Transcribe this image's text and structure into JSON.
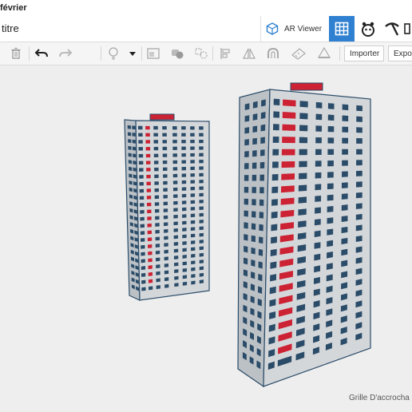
{
  "top_strip": {
    "text": "février"
  },
  "header": {
    "title": "titre",
    "ar_viewer_label": "AR Viewer",
    "grid_icon": "grid-icon",
    "blocks_icon": "blocks-icon",
    "pickaxe_icon": "pickaxe-icon"
  },
  "toolbar": {
    "icons": [
      "trash-icon",
      "undo-icon",
      "redo-icon",
      "lightbulb-icon",
      "chevron-down-icon",
      "image-icon",
      "group-icon",
      "ungroup-icon",
      "align-icon",
      "mirror-icon",
      "magnet-icon",
      "ruler-icon",
      "workplane-icon"
    ],
    "import_label": "Importer",
    "export_label": "Expor"
  },
  "viewport": {
    "snap_grid_label": "Grille D'accrocha",
    "objects": [
      "building-left",
      "building-right"
    ]
  },
  "colors": {
    "accent": "#2f80d0",
    "building_face": "#d4d7da",
    "building_side": "#bcc1c6",
    "building_outline": "#2b4c69",
    "window": "#2b4c69",
    "red_accent": "#cc2233",
    "viewport_bg": "#eeeeee"
  }
}
